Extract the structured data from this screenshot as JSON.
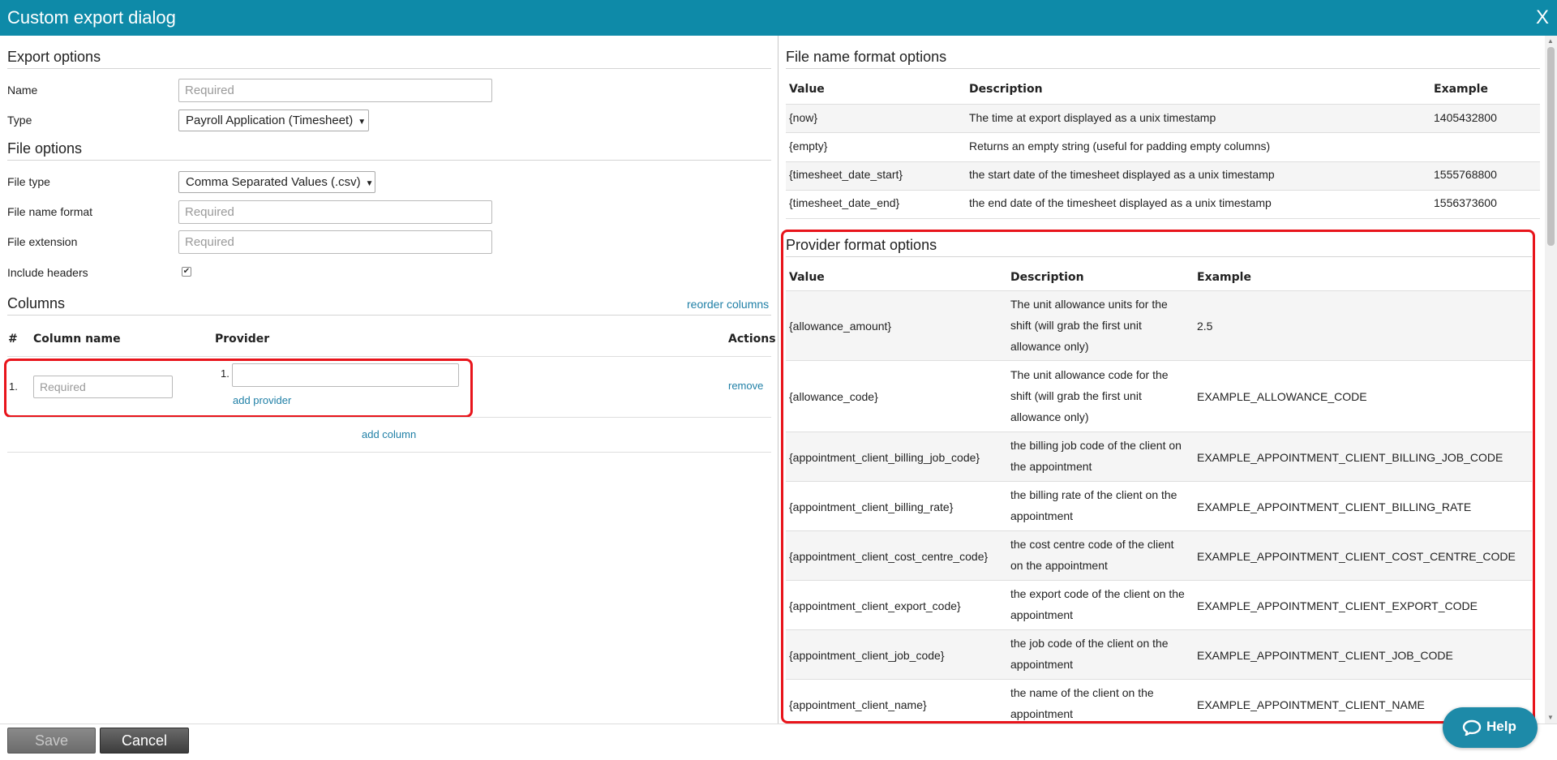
{
  "dialog": {
    "title": "Custom export dialog",
    "close_label": "X"
  },
  "export_options": {
    "heading": "Export options",
    "name_label": "Name",
    "name_placeholder": "Required",
    "type_label": "Type",
    "type_value": "Payroll Application (Timesheet)"
  },
  "file_options": {
    "heading": "File options",
    "file_type_label": "File type",
    "file_type_value": "Comma Separated Values (.csv)",
    "file_name_format_label": "File name format",
    "file_name_format_placeholder": "Required",
    "file_extension_label": "File extension",
    "file_extension_placeholder": "Required",
    "include_headers_label": "Include headers",
    "include_headers_checked": true
  },
  "columns": {
    "heading": "Columns",
    "reorder_label": "reorder columns",
    "headers": {
      "num": "#",
      "name": "Column name",
      "provider": "Provider",
      "actions": "Actions"
    },
    "rows": [
      {
        "num": "1.",
        "name_placeholder": "Required",
        "provider_num": "1.",
        "add_provider": "add provider",
        "remove": "remove"
      }
    ],
    "add_column": "add column"
  },
  "file_name_format_options": {
    "heading": "File name format options",
    "headers": {
      "value": "Value",
      "description": "Description",
      "example": "Example"
    },
    "rows": [
      {
        "value": "{now}",
        "description": "The time at export displayed as a unix timestamp",
        "example": "1405432800"
      },
      {
        "value": "{empty}",
        "description": "Returns an empty string (useful for padding empty columns)",
        "example": ""
      },
      {
        "value": "{timesheet_date_start}",
        "description": "the start date of the timesheet displayed as a unix timestamp",
        "example": "1555768800"
      },
      {
        "value": "{timesheet_date_end}",
        "description": "the end date of the timesheet displayed as a unix timestamp",
        "example": "1556373600"
      }
    ]
  },
  "provider_format_options": {
    "heading": "Provider format options",
    "headers": {
      "value": "Value",
      "description": "Description",
      "example": "Example"
    },
    "rows": [
      {
        "value": "{allowance_amount}",
        "desc_lines": [
          "The unit allowance units for the",
          "shift (will grab the first unit",
          "allowance only)"
        ],
        "example": "2.5"
      },
      {
        "value": "{allowance_code}",
        "desc_lines": [
          "The unit allowance code for the",
          "shift (will grab the first unit",
          "allowance only)"
        ],
        "example": "EXAMPLE_ALLOWANCE_CODE"
      },
      {
        "value": "{appointment_client_billing_job_code}",
        "desc_lines": [
          "the billing job code of the client on",
          "the appointment"
        ],
        "example": "EXAMPLE_APPOINTMENT_CLIENT_BILLING_JOB_CODE"
      },
      {
        "value": "{appointment_client_billing_rate}",
        "desc_lines": [
          "the billing rate of the client on the",
          "appointment"
        ],
        "example": "EXAMPLE_APPOINTMENT_CLIENT_BILLING_RATE"
      },
      {
        "value": "{appointment_client_cost_centre_code}",
        "desc_lines": [
          "the cost centre code of the client",
          "on the appointment"
        ],
        "example": "EXAMPLE_APPOINTMENT_CLIENT_COST_CENTRE_CODE"
      },
      {
        "value": "{appointment_client_export_code}",
        "desc_lines": [
          "the export code of the client on the",
          "appointment"
        ],
        "example": "EXAMPLE_APPOINTMENT_CLIENT_EXPORT_CODE"
      },
      {
        "value": "{appointment_client_job_code}",
        "desc_lines": [
          "the job code of the client on the",
          "appointment"
        ],
        "example": "EXAMPLE_APPOINTMENT_CLIENT_JOB_CODE"
      },
      {
        "value": "{appointment_client_name}",
        "desc_lines": [
          "the name of the client on the",
          "appointment"
        ],
        "example": "EXAMPLE_APPOINTMENT_CLIENT_NAME"
      }
    ]
  },
  "footer": {
    "save_label": "Save",
    "cancel_label": "Cancel"
  },
  "help": {
    "label": "Help"
  },
  "colors": {
    "titlebar": "#0e8aa8",
    "link": "#1f7fa6",
    "highlight": "#e8141b",
    "help": "#1d8aa8"
  }
}
